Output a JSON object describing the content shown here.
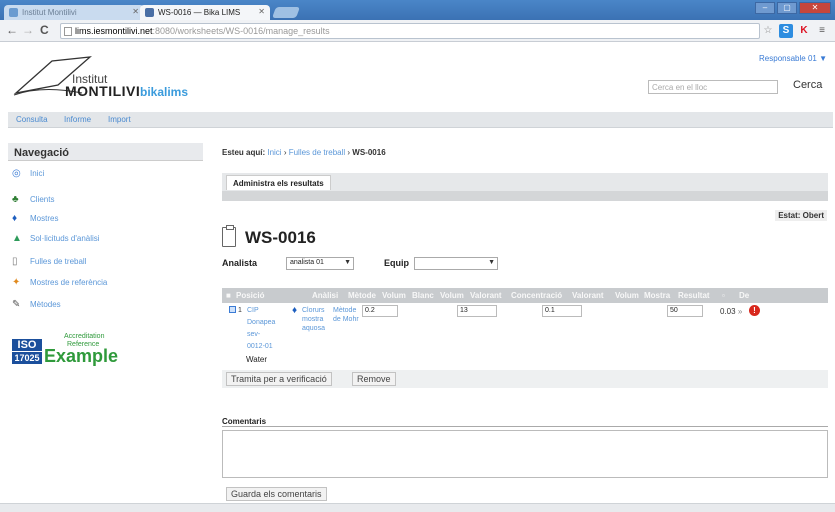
{
  "browser": {
    "tabs": [
      {
        "title": "Institut Montilivi"
      },
      {
        "title": "WS-0016 — Bika LIMS"
      }
    ],
    "url": {
      "host": "lims.iesmontilivi.net",
      "rest": ":8080/worksheets/WS-0016/manage_results"
    }
  },
  "header": {
    "user_menu": "Responsable 01 ▼",
    "logo": {
      "line1": "Institut",
      "line2": "MONTILIVI",
      "brand": "bikalims"
    },
    "search_placeholder": "Cerca en el lloc",
    "search_button": "Cerca"
  },
  "menubar": {
    "items": [
      {
        "label": "Consulta"
      },
      {
        "label": "Informe"
      },
      {
        "label": "Import"
      }
    ]
  },
  "sidebar": {
    "title": "Navegació",
    "items": [
      {
        "label": "Inici",
        "icon": "home-icon"
      },
      {
        "label": "Clients",
        "icon": "clients-icon"
      },
      {
        "label": "Mostres",
        "icon": "sample-drop-icon"
      },
      {
        "label": "Sol·licituds d'anàlisi",
        "icon": "flask-icon"
      },
      {
        "label": "Fulles de treball",
        "icon": "worksheet-icon"
      },
      {
        "label": "Mostres de referència",
        "icon": "reference-sample-icon"
      },
      {
        "label": "Mètodes",
        "icon": "pen-icon"
      }
    ],
    "badge": {
      "iso": "ISO",
      "number": "17025",
      "line1": "Accreditation",
      "line2": "Reference",
      "example": "Example"
    }
  },
  "main": {
    "breadcrumb": {
      "label": "Esteu aquí:",
      "items": [
        "Inici",
        "Fulles de treball"
      ],
      "current": "WS-0016"
    },
    "tab_label": "Administra els resultats",
    "status": "Estat: Obert",
    "title": "WS-0016",
    "analist_label": "Analista",
    "analist_value": "analista 01",
    "equip_label": "Equip",
    "equip_value": "",
    "table": {
      "headers": [
        "Posició",
        "Anàlisi",
        "Mètode",
        "Volum",
        "Blanc",
        "Volum",
        "Valorant",
        "Concentració",
        "Valorant",
        "Volum",
        "Mostra",
        "Resultat",
        "De"
      ],
      "row": {
        "position": "1",
        "sample_line1": "CIP",
        "sample_line2": "Donapea",
        "sample_line3": "sev-",
        "sample_line4": "0012-01",
        "sample_type": "Water",
        "analysis_line1": "Clorurs",
        "analysis_line2": "mostra",
        "analysis_line3": "aquosa",
        "method_line1": "Mètode",
        "method_line2": "de Mohr",
        "v1": "0.2",
        "v2": "13",
        "v3": "0.1",
        "v4": "50",
        "result": "0.03",
        "result_suffix": "»"
      }
    },
    "buttons": {
      "submit": "Tramita per a verificació",
      "remove": "Remove"
    },
    "comments_label": "Comentaris",
    "save_comments": "Guarda els comentaris"
  }
}
